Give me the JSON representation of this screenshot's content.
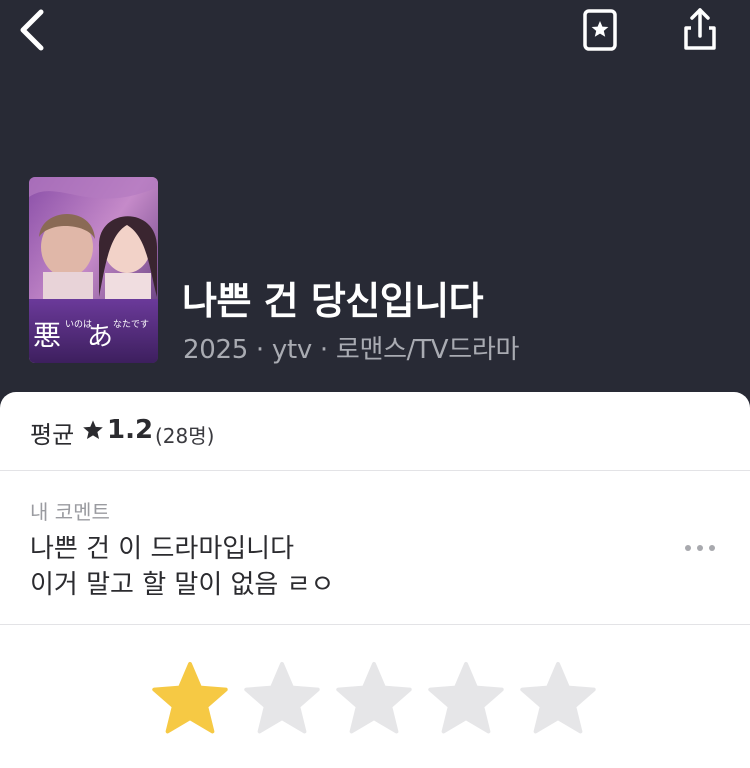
{
  "nav": {
    "back_icon": "chevron-left-icon",
    "bookmark_icon": "bookmark-star-icon",
    "share_icon": "share-icon"
  },
  "movie": {
    "title": "나쁜 건 당신입니다",
    "meta": "2025 · ytv · 로맨스/TV드라마",
    "poster_text": "悪いのはあなたです"
  },
  "rating": {
    "label": "평균",
    "value": "1.2",
    "count": "(28명)"
  },
  "my_comment": {
    "label": "내 코멘트",
    "line1": "나쁜 건 이 드라마입니다",
    "line2": "이거 말고 할 말이 없음 ㄹㅇ",
    "more_icon": "more-horizontal-icon"
  },
  "user_rating": {
    "stars_filled": 1,
    "stars_total": 5
  },
  "colors": {
    "header_bg": "#282a35",
    "star_filled": "#f6c944",
    "star_empty": "#e6e6e8",
    "text_dark": "#2b2b2f",
    "text_muted": "#9a9ba0"
  }
}
